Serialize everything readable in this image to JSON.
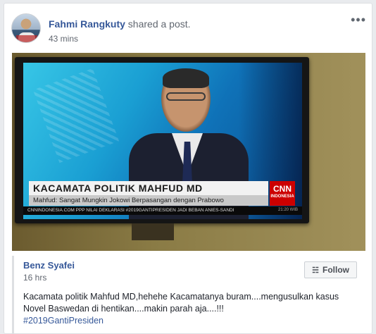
{
  "post": {
    "author": "Fahmi Rangkuty",
    "action": "shared a post.",
    "time": "43 mins",
    "more_icon": "more-options-icon",
    "more_glyph": "•••"
  },
  "image": {
    "headline": "KACAMATA POLITIK MAHFUD MD",
    "subheadline": "Mahfud: Sangat Mungkin Jokowi Berpasangan dengan Prabowo",
    "ticker": "CNNINDONESIA.COM  PPP NILAI DEKLARASI #2019GANTIPRESIDEN JADI BEBAN ANIES-SANDI",
    "logo": "CNN",
    "logo_sub": "INDONESIA",
    "clock": "21:20 WIB"
  },
  "shared_post": {
    "author": "Benz Syafei",
    "time": "16 hrs",
    "follow_label": "Follow",
    "follow_icon": "rss-icon",
    "text_line1": "Kacamata politik Mahfud MD,hehehe Kacamatanya buram....mengusulkan kasus",
    "text_line2": "Novel Baswedan di hentikan....makin parah aja....!!!",
    "hashtag": "#2019GantiPresiden"
  },
  "colors": {
    "link": "#365899",
    "meta": "#616770",
    "cnn_red": "#cc0000"
  }
}
